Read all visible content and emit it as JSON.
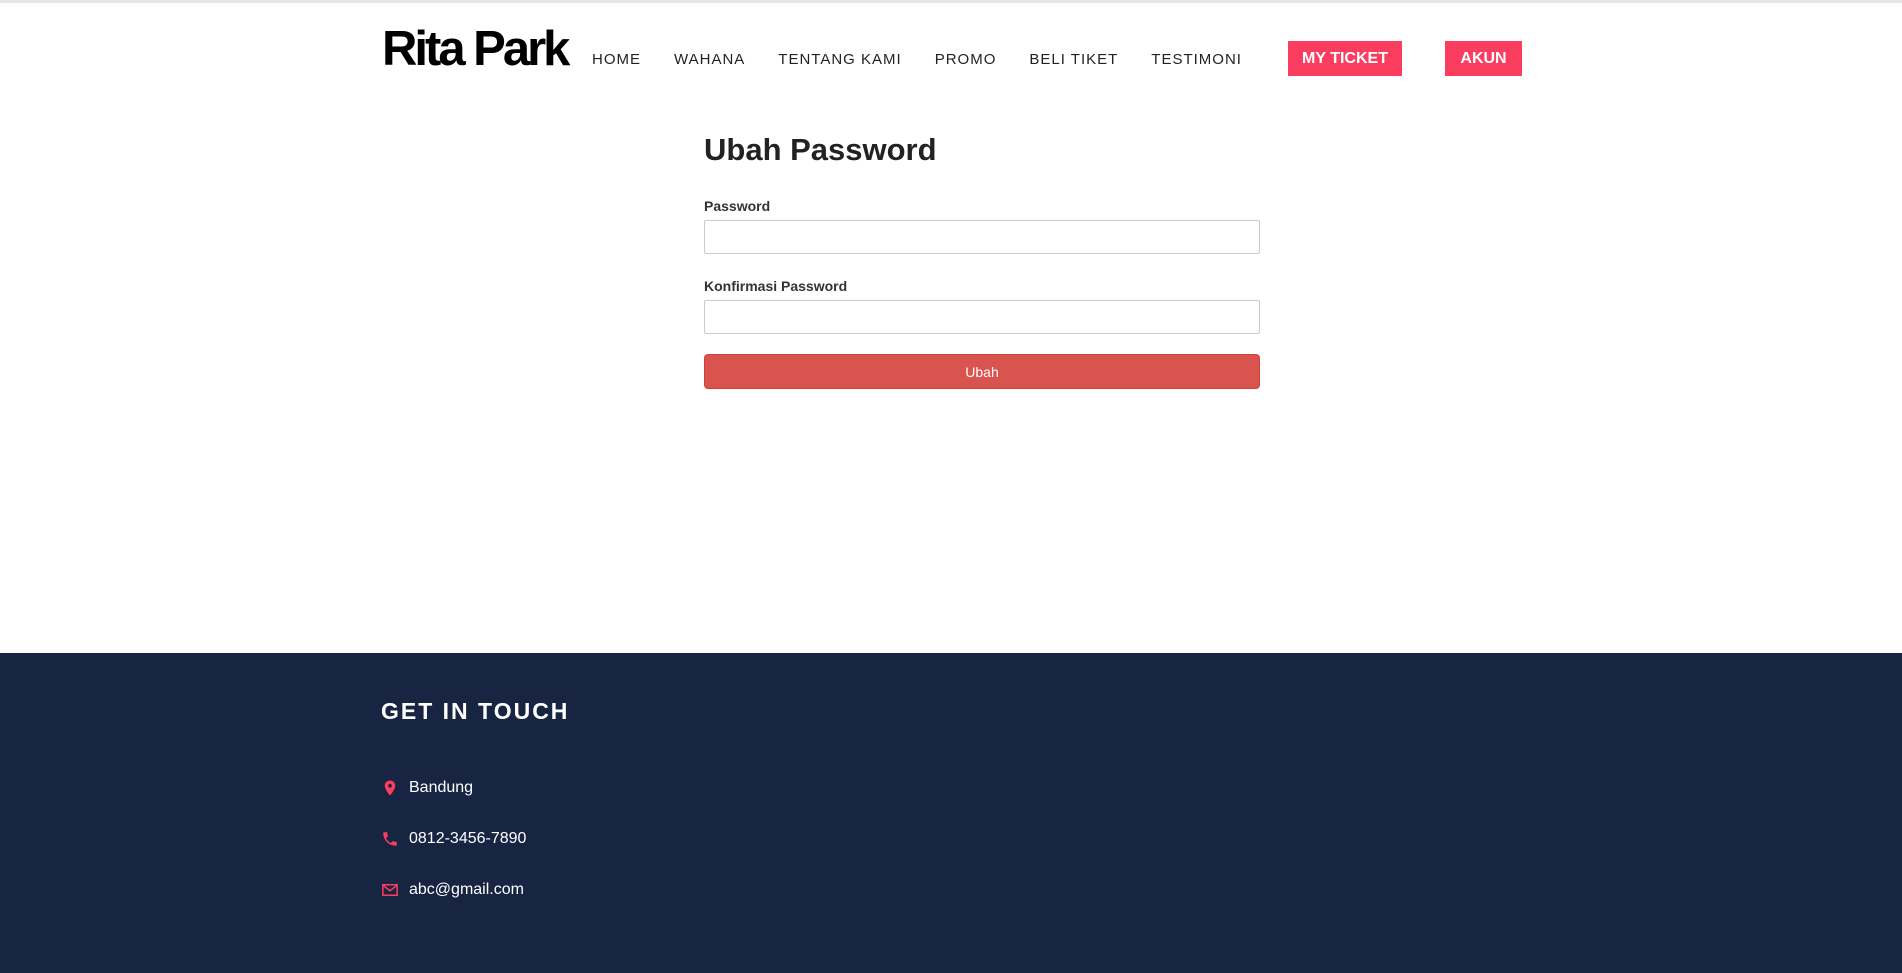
{
  "header": {
    "logo": "Rita Park",
    "nav": [
      {
        "label": "HOME"
      },
      {
        "label": "WAHANA"
      },
      {
        "label": "TENTANG KAMI"
      },
      {
        "label": "PROMO"
      },
      {
        "label": "BELI TIKET"
      },
      {
        "label": "TESTIMONI"
      }
    ],
    "my_ticket_label": "MY TICKET",
    "akun_label": "AKUN"
  },
  "form": {
    "title": "Ubah Password",
    "password_label": "Password",
    "password_value": "",
    "confirm_label": "Konfirmasi Password",
    "confirm_value": "",
    "submit_label": "Ubah"
  },
  "footer": {
    "title": "GET IN TOUCH",
    "location": "Bandung",
    "phone": "0812-3456-7890",
    "email": "abc@gmail.com"
  },
  "colors": {
    "accent": "#fb3d5f",
    "submit": "#d9534f",
    "footer_bg": "#172543"
  },
  "icons": {
    "location": "map-marker-icon",
    "phone": "phone-icon",
    "email": "envelope-icon"
  }
}
